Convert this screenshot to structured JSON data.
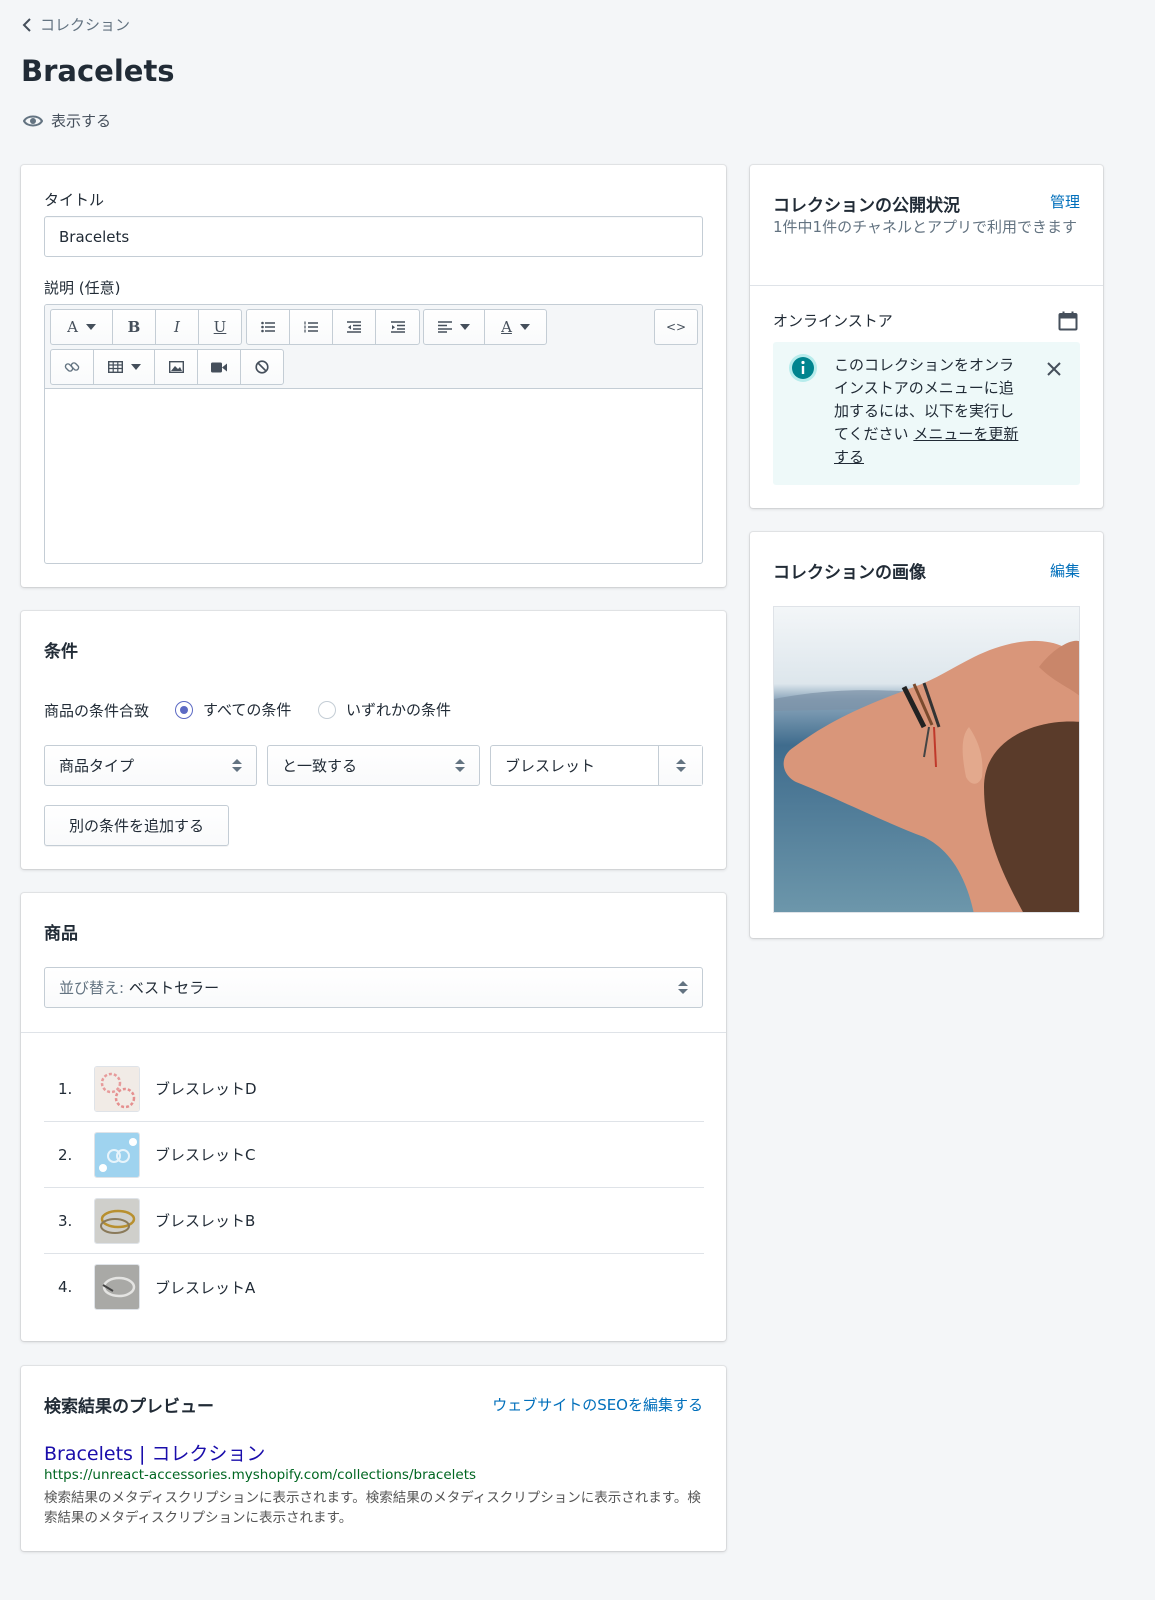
{
  "header": {
    "breadcrumb": "コレクション",
    "title": "Bracelets",
    "view_label": "表示する"
  },
  "details": {
    "title_label": "タイトル",
    "title_value": "Bracelets",
    "description_label": "説明 (任意)",
    "toolbar": {
      "font": "A",
      "bold": "B",
      "italic": "I",
      "underline": "U",
      "color": "A",
      "html": "<>"
    }
  },
  "conditions": {
    "heading": "条件",
    "match_label": "商品の条件合致",
    "option_all": "すべての条件",
    "option_any": "いずれかの条件",
    "selected": "all",
    "field": "商品タイプ",
    "operator": "と一致する",
    "value": "ブレスレット",
    "add_button": "別の条件を追加する"
  },
  "products": {
    "heading": "商品",
    "sort_prefix": "並び替え:",
    "sort_value": "ベストセラー",
    "items": [
      {
        "num": "1.",
        "name": "ブレスレットD"
      },
      {
        "num": "2.",
        "name": "ブレスレットC"
      },
      {
        "num": "3.",
        "name": "ブレスレットB"
      },
      {
        "num": "4.",
        "name": "ブレスレットA"
      }
    ]
  },
  "seo": {
    "heading": "検索結果のプレビュー",
    "edit_link": "ウェブサイトのSEOを編集する",
    "preview_title": "Bracelets | コレクション",
    "preview_url": "https://unreact-accessories.myshopify.com/collections/bracelets",
    "preview_desc": "検索結果のメタディスクリプションに表示されます。検索結果のメタディスクリプションに表示されます。検索結果のメタディスクリプションに表示されます。"
  },
  "availability": {
    "heading": "コレクションの公開状況",
    "manage_link": "管理",
    "subtext": "1件中1件のチャネルとアプリで利用できます",
    "channel": "オンラインストア",
    "banner_text": "このコレクションをオンラインストアのメニューに追加するには、以下を実行してください",
    "banner_link": "メニューを更新する"
  },
  "image": {
    "heading": "コレクションの画像",
    "edit_link": "編集"
  },
  "colors": {
    "accent": "#006fbb",
    "radio": "#5c6ac4",
    "banner_bg": "#eef9f9",
    "info_icon": "#47c1bf",
    "seo_title": "#1a0dab",
    "seo_url": "#006621"
  }
}
